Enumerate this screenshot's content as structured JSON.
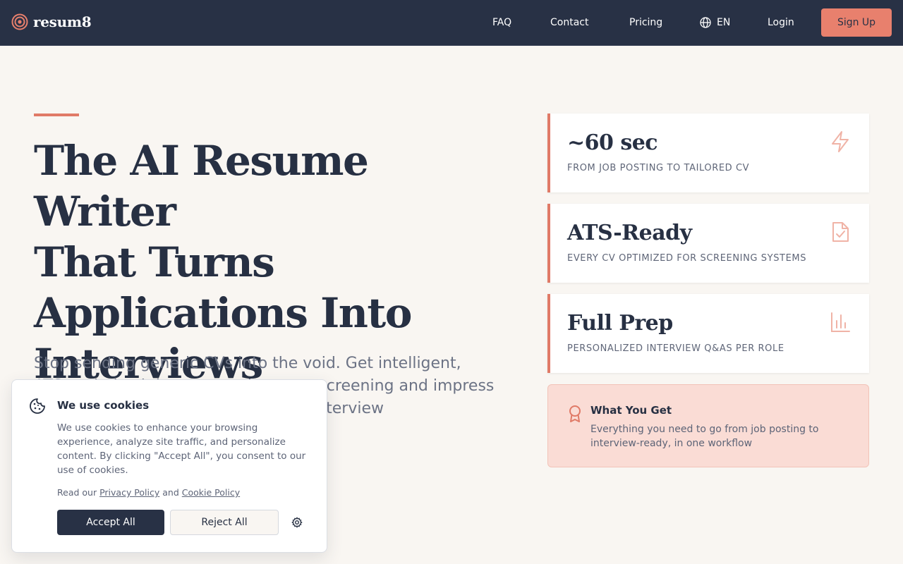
{
  "header": {
    "brand": "resum8",
    "nav": [
      "FAQ",
      "Contact",
      "Pricing"
    ],
    "language": "EN",
    "login": "Login",
    "signup": "Sign Up"
  },
  "hero": {
    "title_lines": [
      "The AI Resume Writer",
      "That Turns",
      "Applications Into",
      "Interviews"
    ],
    "subtitle": "Stop sending generic CVs into the void. Get intelligent, ATS-optimized documents that pass screening and impress hiring managers, plus personalized interview"
  },
  "stats": [
    {
      "value": "~60 sec",
      "caption": "FROM JOB POSTING TO TAILORED CV",
      "icon": "lightning-icon"
    },
    {
      "value": "ATS-Ready",
      "caption": "EVERY CV OPTIMIZED FOR SCREENING SYSTEMS",
      "icon": "document-check-icon"
    },
    {
      "value": "Full Prep",
      "caption": "PERSONALIZED INTERVIEW Q&AS PER ROLE",
      "icon": "bar-chart-icon"
    }
  ],
  "what_you_get": {
    "title": "What You Get",
    "description": "Everything you need to go from job posting to interview-ready, in one workflow",
    "icon": "award-icon"
  },
  "cookie": {
    "title": "We use cookies",
    "body": "We use cookies to enhance your browsing experience, analyze site traffic, and personalize content. By clicking \"Accept All\", you consent to our use of cookies.",
    "read_prefix": "Read our",
    "privacy_link": "Privacy Policy",
    "and": "and",
    "cookie_link": "Cookie Policy",
    "accept": "Accept All",
    "reject": "Reject All"
  },
  "colors": {
    "header_bg": "#283145",
    "accent": "#e07a67",
    "signup_bg": "#e8806d",
    "page_bg": "#f9f6f2",
    "callout_bg": "#fadcd5"
  }
}
